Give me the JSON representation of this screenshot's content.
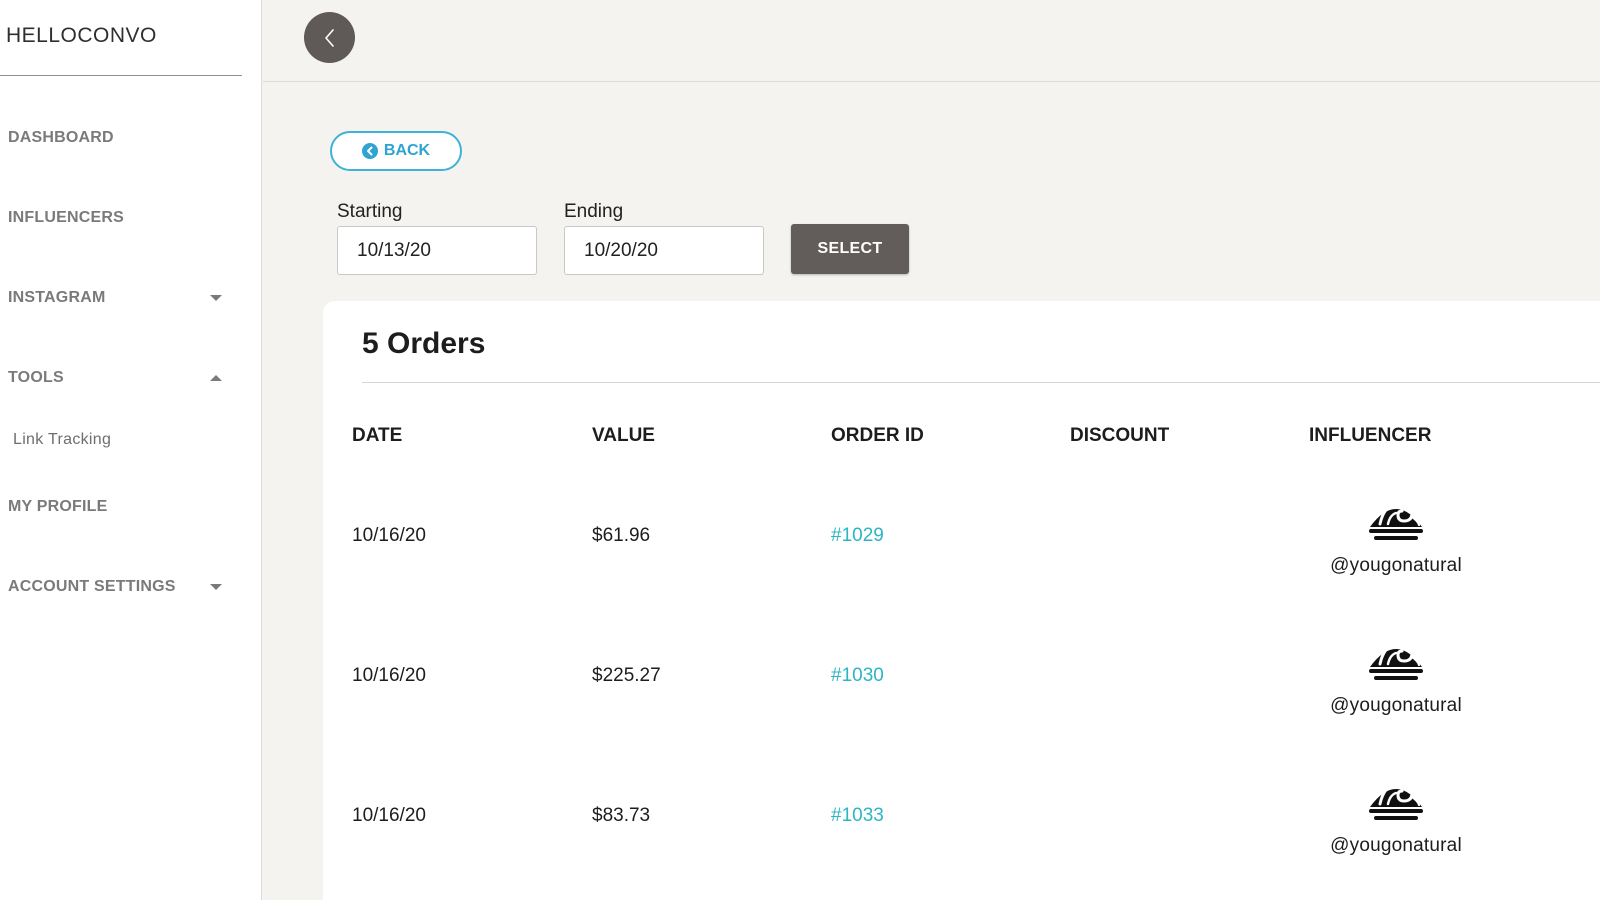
{
  "brand": "HELLOCONVO",
  "nav": {
    "dashboard": "DASHBOARD",
    "influencers": "INFLUENCERS",
    "instagram": "INSTAGRAM",
    "tools": "TOOLS",
    "link_tracking": "Link Tracking",
    "my_profile": "MY PROFILE",
    "account_settings": "ACCOUNT SETTINGS"
  },
  "back_label": "BACK",
  "filters": {
    "starting_label": "Starting",
    "starting_value": "10/13/20",
    "ending_label": "Ending",
    "ending_value": "10/20/20",
    "select_label": "SELECT"
  },
  "orders": {
    "title": "5 Orders",
    "headers": [
      "DATE",
      "VALUE",
      "ORDER ID",
      "DISCOUNT",
      "INFLUENCER"
    ],
    "rows": [
      {
        "date": "10/16/20",
        "value": "$61.96",
        "order_id": "#1029",
        "discount": "",
        "influencer": "@yougonatural"
      },
      {
        "date": "10/16/20",
        "value": "$225.27",
        "order_id": "#1030",
        "discount": "",
        "influencer": "@yougonatural"
      },
      {
        "date": "10/16/20",
        "value": "$83.73",
        "order_id": "#1033",
        "discount": "",
        "influencer": "@yougonatural"
      }
    ]
  },
  "icons": {
    "back_circle": "chevron-left-icon",
    "back_pill": "circle-arrow-left-icon",
    "avatar": "wave-logo-icon"
  },
  "colors": {
    "accent_blue": "#2fa3d1",
    "link_teal": "#2bb6c4",
    "dark_button": "#625d5a"
  }
}
